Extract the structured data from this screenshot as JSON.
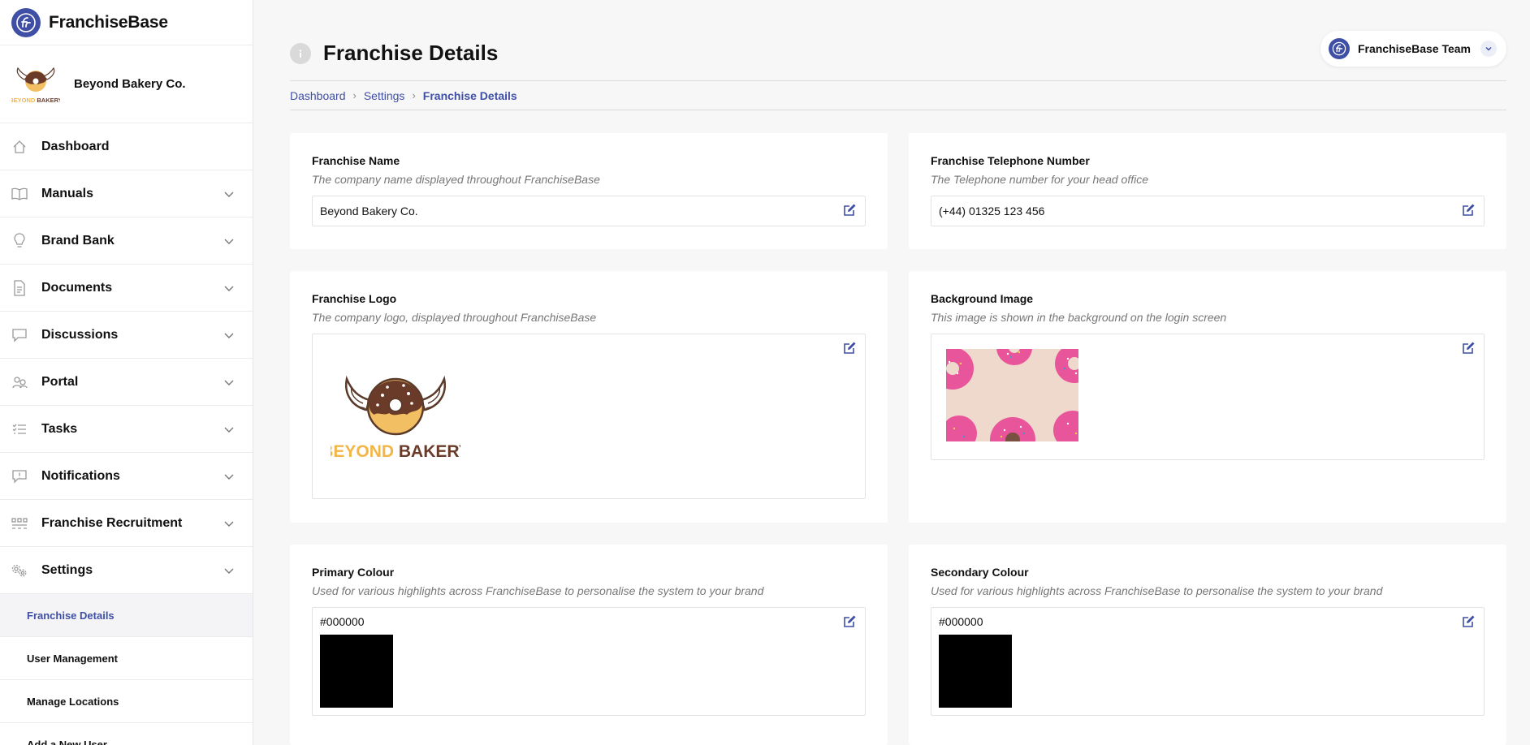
{
  "brand": {
    "name": "FranchiseBase"
  },
  "company": {
    "name": "Beyond Bakery Co."
  },
  "nav": [
    {
      "label": "Dashboard",
      "icon": "home-icon",
      "has_chevron": false
    },
    {
      "label": "Manuals",
      "icon": "book-icon",
      "has_chevron": true
    },
    {
      "label": "Brand Bank",
      "icon": "lightbulb-icon",
      "has_chevron": true
    },
    {
      "label": "Documents",
      "icon": "document-icon",
      "has_chevron": true
    },
    {
      "label": "Discussions",
      "icon": "chat-icon",
      "has_chevron": true
    },
    {
      "label": "Portal",
      "icon": "portal-icon",
      "has_chevron": true
    },
    {
      "label": "Tasks",
      "icon": "tasks-icon",
      "has_chevron": true
    },
    {
      "label": "Notifications",
      "icon": "notification-icon",
      "has_chevron": true
    },
    {
      "label": "Franchise Recruitment",
      "icon": "recruitment-icon",
      "has_chevron": true
    },
    {
      "label": "Settings",
      "icon": "settings-icon",
      "has_chevron": true
    }
  ],
  "settings_sub": [
    {
      "label": "Franchise Details",
      "active": true
    },
    {
      "label": "User Management",
      "active": false
    },
    {
      "label": "Manage Locations",
      "active": false
    },
    {
      "label": "Add a New User",
      "active": false
    }
  ],
  "header": {
    "title": "Franchise Details",
    "team": "FranchiseBase Team"
  },
  "breadcrumb": [
    "Dashboard",
    "Settings",
    "Franchise Details"
  ],
  "cards": {
    "name": {
      "title": "Franchise Name",
      "desc": "The company name displayed throughout FranchiseBase",
      "value": "Beyond Bakery Co."
    },
    "phone": {
      "title": "Franchise Telephone Number",
      "desc": "The Telephone number for your head office",
      "value": "(+44) 01325 123 456"
    },
    "logo": {
      "title": "Franchise Logo",
      "desc": "The company logo, displayed throughout FranchiseBase",
      "logo_text_1": "BEYOND",
      "logo_text_2": "BAKERY"
    },
    "background": {
      "title": "Background Image",
      "desc": "This image is shown in the background on the login screen"
    },
    "primary": {
      "title": "Primary Colour",
      "desc": "Used for various highlights across FranchiseBase to personalise the system to your brand",
      "value": "#000000"
    },
    "secondary": {
      "title": "Secondary Colour",
      "desc": "Used for various highlights across FranchiseBase to personalise the system to your brand",
      "value": "#000000"
    }
  },
  "colors": {
    "accent": "#3f4fa5",
    "primary_swatch": "#000000",
    "secondary_swatch": "#000000"
  }
}
